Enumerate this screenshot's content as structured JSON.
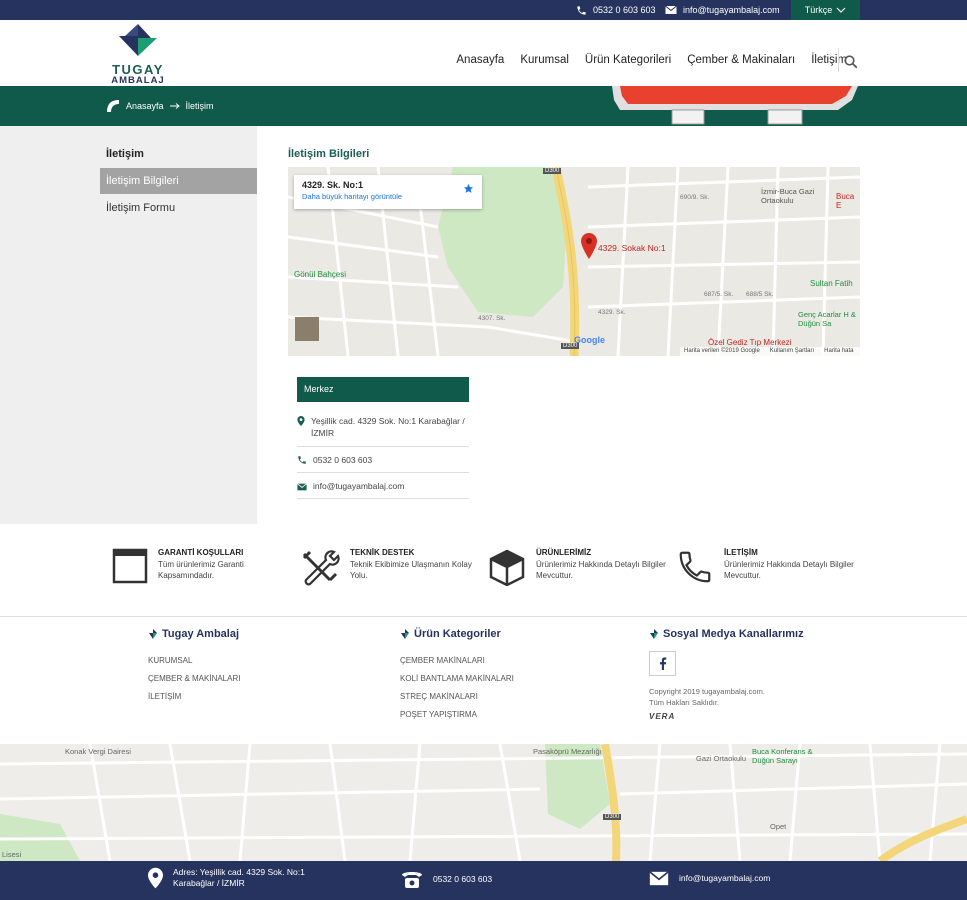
{
  "topbar": {
    "phone": "0532 0 603 603",
    "email": "info@tugayambalaj.com",
    "language": "Türkçe"
  },
  "header": {
    "logo_line1": "TUGAY",
    "logo_line2": "AMBALAJ",
    "nav": [
      "Anasayfa",
      "Kurumsal",
      "Ürün Kategorileri",
      "Çember & Makinaları",
      "İletişim"
    ]
  },
  "breadcrumb": {
    "home": "Anasayfa",
    "current": "İletişim"
  },
  "sidebar": {
    "title": "İletişim",
    "items": [
      "İletişim Bilgileri",
      "İletişim Formu"
    ]
  },
  "content": {
    "heading": "İletişim Bilgileri",
    "map": {
      "place_title": "4329. Sk. No:1",
      "larger_map": "Daha büyük haritayı görüntüle",
      "marker_label": "4329. Sokak No:1",
      "attribution": "Harita verileri ©2019 Google",
      "terms": "Kullanım Şartları",
      "report": "Harita hata",
      "labels": [
        "İzmir-Buca Gazi Ortaokulu",
        "Gönül Bahçesi",
        "Sultan Fatih",
        "Genç Acarlar H & Düğün Sa",
        "Özel Gediz Tıp Merkezi",
        "Buca E",
        "D300",
        "D300",
        "4329. Sk.",
        "4307. Sk.",
        "687/5. Sk.",
        "688/5 Sk.",
        "690/9. Sk."
      ]
    },
    "office": {
      "title": "Merkez",
      "address": "Yeşillik cad. 4329 Sok. No:1 Karabağlar / İZMİR",
      "phone": "0532 0 603 603",
      "email": "info@tugayambalaj.com"
    }
  },
  "features": [
    {
      "title": "GARANTİ KOŞULLARI",
      "desc": "Tüm ürünlerimiz Garanti Kapsamındadır."
    },
    {
      "title": "TEKNİK DESTEK",
      "desc": "Teknik Ekibimize Ulaşmanın Kolay Yolu."
    },
    {
      "title": "ÜRÜNLERİMİZ",
      "desc": "Ürünlerimiz Hakkında Detaylı Bilgiler Mevcuttur."
    },
    {
      "title": "İLETİŞİM",
      "desc": "Ürünlerimiz Hakkında Detaylı Bilgiler Mevcuttur."
    }
  ],
  "footer": {
    "col1_title": "Tugay Ambalaj",
    "col1_links": [
      "KURUMSAL",
      "ÇEMBER & MAKİNALARI",
      "İLETİŞİM"
    ],
    "col2_title": "Ürün Kategoriler",
    "col2_links": [
      "ÇEMBER MAKİNALARI",
      "KOLİ BANTLAMA MAKİNALARI",
      "STREÇ MAKİNALARI",
      "POŞET YAPIŞTIRMA"
    ],
    "col3_title": "Sosyal Medya Kanallarımız",
    "copyright1": "Copyright 2019 tugayambalaj.com.",
    "copyright2": "Tüm Hakları Saklıdır.",
    "agency": "VERA",
    "map_labels": [
      "Konak Vergi Dairesi",
      "Pasaköprü Mezarlığı",
      "Buca Konferans & Düğün Sarayı",
      "Gazi Ortaokulu",
      "Lisesi",
      "D300",
      "Opet"
    ]
  },
  "bottombar": {
    "address_line1": "Adres: Yeşillik cad. 4329 Sok. No:1",
    "address_line2": "Karabağlar / İZMİR",
    "phone": "0532 0 603 603",
    "email": "info@tugayambalaj.com"
  },
  "colors": {
    "navy": "#26335e",
    "green": "#0f5a4a",
    "sidebar_active": "#a3a3a3"
  }
}
